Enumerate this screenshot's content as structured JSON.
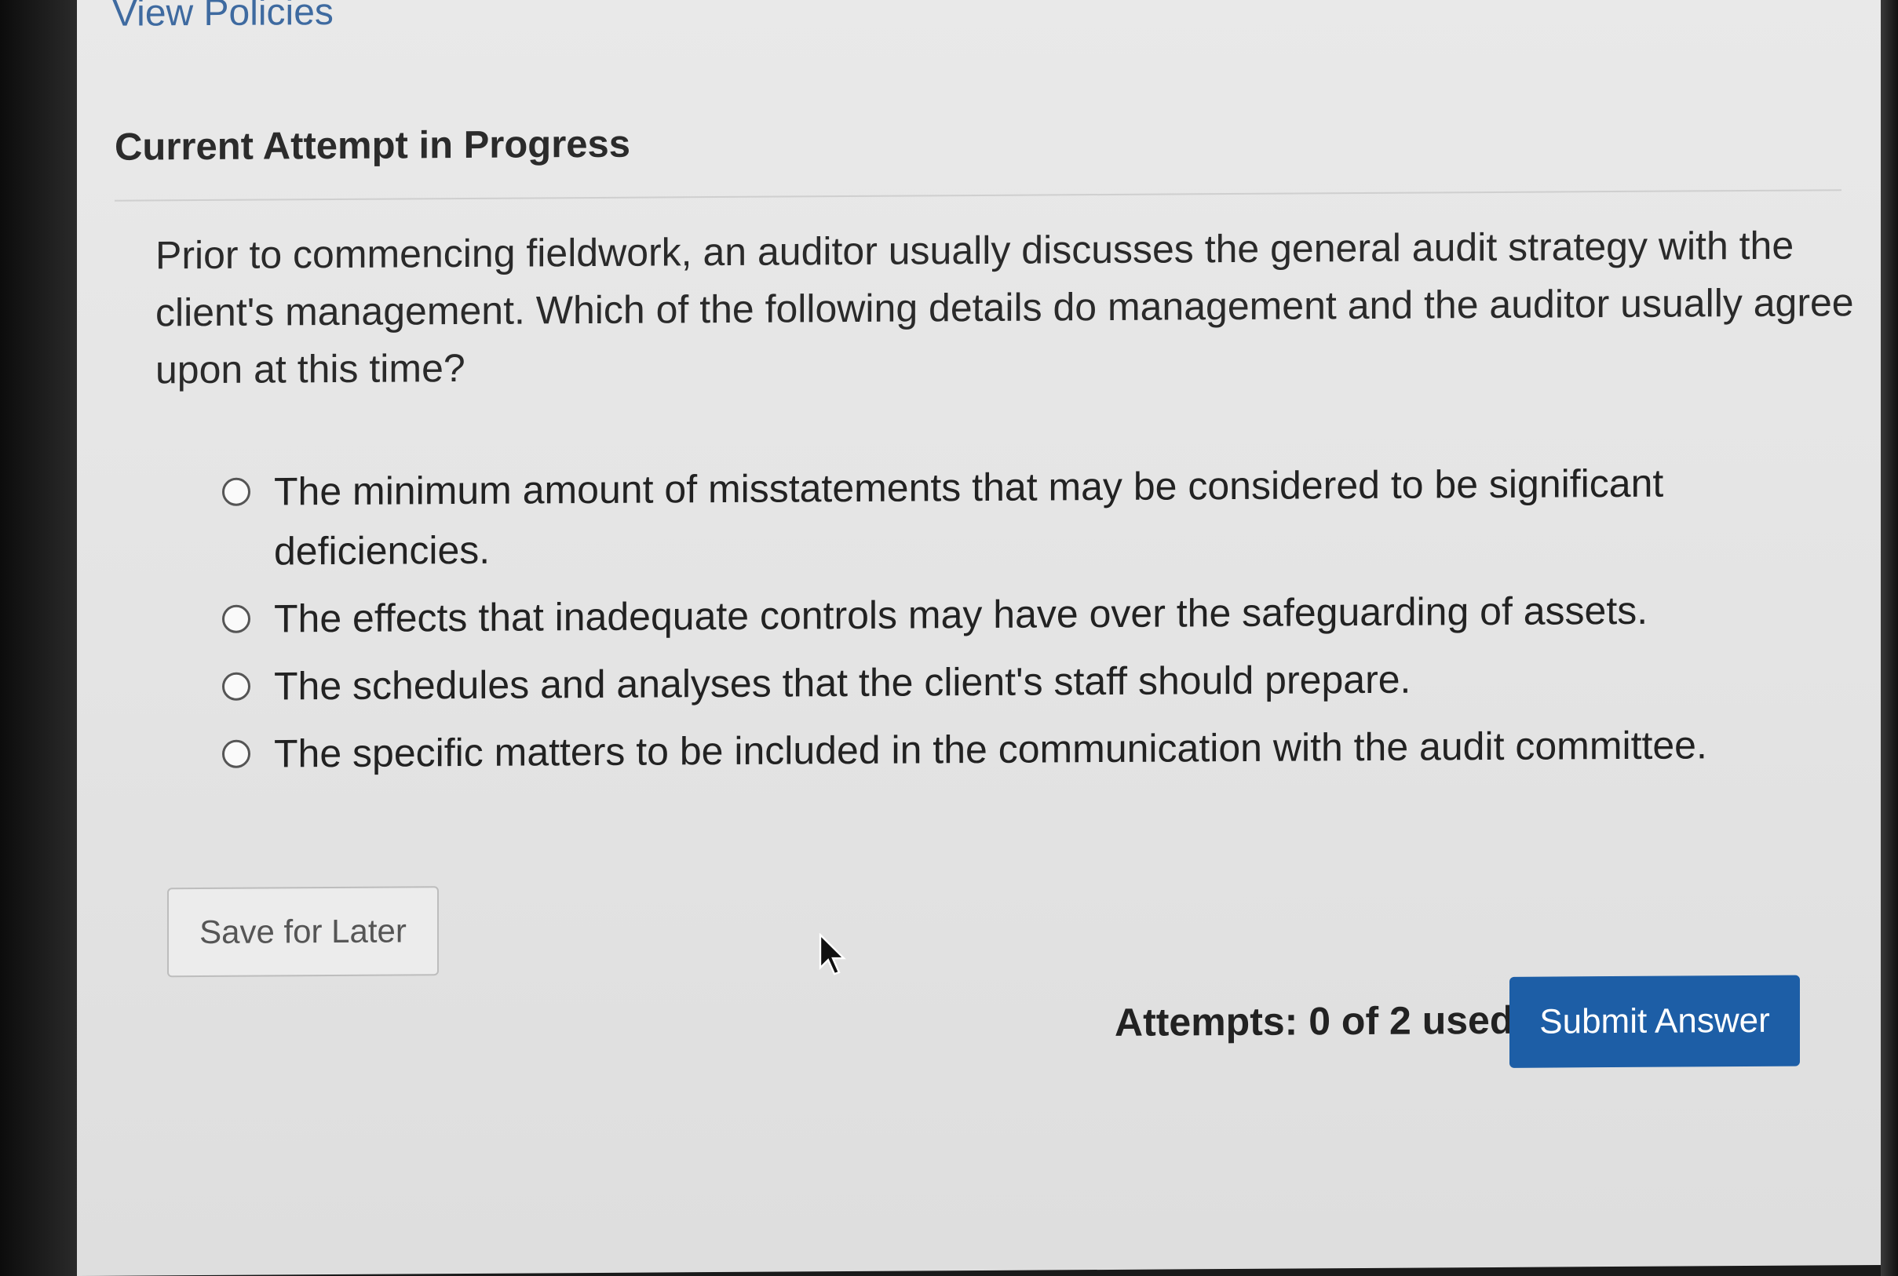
{
  "links": {
    "view_policies": "View Policies"
  },
  "section": {
    "title": "Current Attempt in Progress"
  },
  "question": {
    "text": "Prior to commencing fieldwork, an auditor usually discusses the general audit strategy with the client's management. Which of the following details do management and the auditor usually agree upon at this time?"
  },
  "options": [
    {
      "label": "The minimum amount of misstatements that may be considered to be significant deficiencies."
    },
    {
      "label": "The effects that inadequate controls may have over the safeguarding of assets."
    },
    {
      "label": "The schedules and analyses that the client's staff should prepare."
    },
    {
      "label": "The specific matters to be included in the communication with the audit committee."
    }
  ],
  "actions": {
    "save_label": "Save for Later",
    "attempts_text": "Attempts: 0 of 2 used",
    "submit_label": "Submit Answer"
  },
  "colors": {
    "link": "#3e6aa0",
    "primary_button": "#1d5ea6"
  },
  "icons": {
    "pointer": "mouse-pointer-icon",
    "radio": "radio-unselected-icon"
  }
}
